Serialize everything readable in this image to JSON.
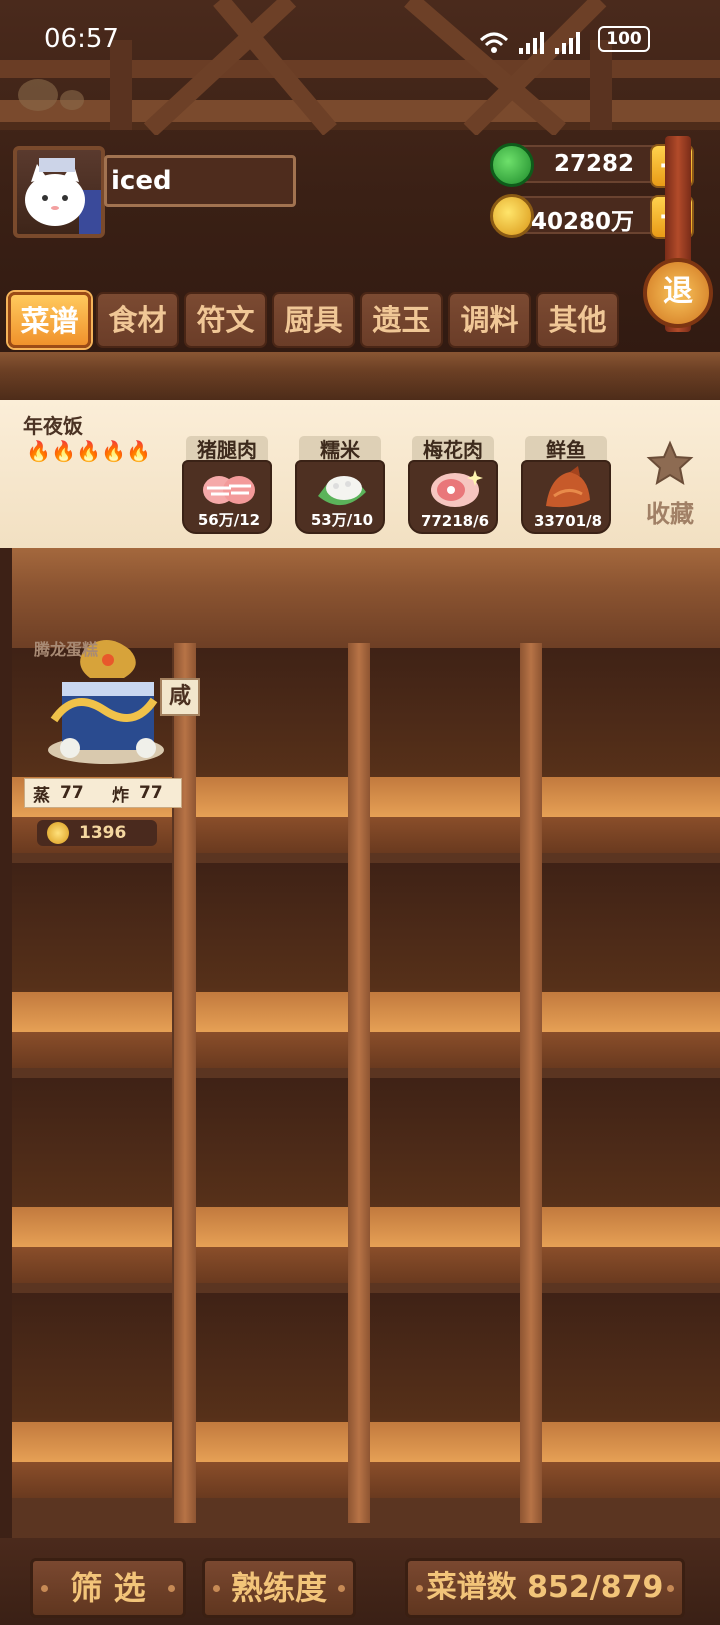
{
  "status": {
    "time": "06:57",
    "battery": "100"
  },
  "player": {
    "name": "iced"
  },
  "currency": {
    "jade": "27282",
    "coins": "40280万"
  },
  "exit_label": "退",
  "tabs": [
    "菜谱",
    "食材",
    "符文",
    "厨具",
    "遗玉",
    "调料",
    "其他"
  ],
  "active_tab": 0,
  "dish": {
    "name": "年夜饭",
    "stars": 5,
    "ingredients": [
      {
        "name": "猪腿肉",
        "count": "56万/12",
        "icon": "pork-leg-icon"
      },
      {
        "name": "糯米",
        "count": "53万/10",
        "icon": "rice-icon"
      },
      {
        "name": "梅花肉",
        "count": "77218/6",
        "icon": "pork-shoulder-icon"
      },
      {
        "name": "鲜鱼",
        "count": "33701/8",
        "icon": "fish-icon"
      }
    ],
    "favorite_label": "收藏"
  },
  "recipe": {
    "name": "腾龙蛋糕",
    "flavor": "咸",
    "skill1_label": "蒸",
    "skill1_value": "77",
    "skill2_label": "炸",
    "skill2_value": "77",
    "price": "1396"
  },
  "bottom": {
    "filter": "筛 选",
    "mastery": "熟练度",
    "count_label": "菜谱数 852/879"
  },
  "colors": {
    "accent": "#f0922c",
    "wood": "#8b5431",
    "bg": "#3d2116"
  }
}
